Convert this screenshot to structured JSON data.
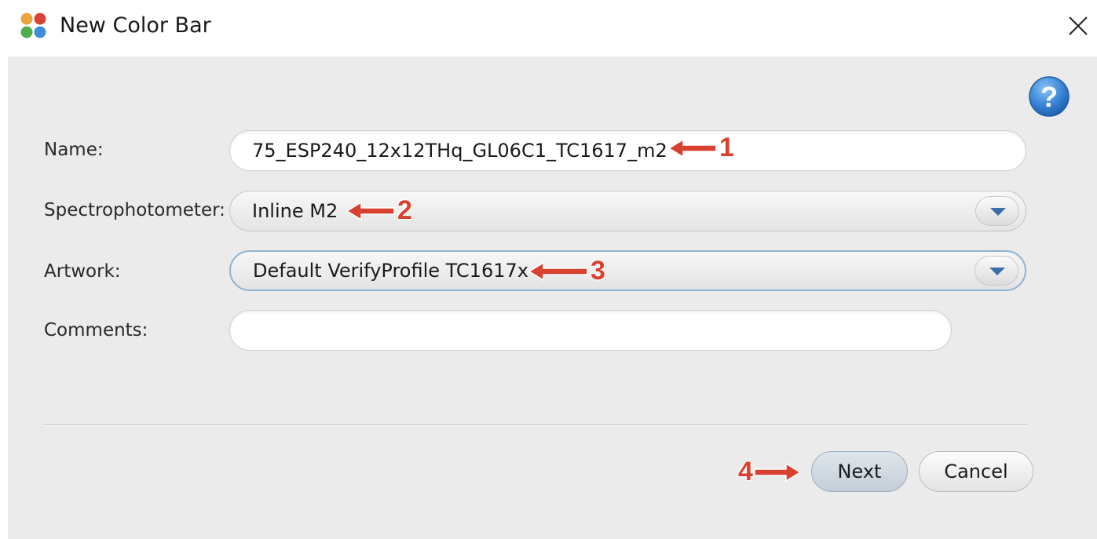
{
  "window": {
    "title": "New Color Bar"
  },
  "form": {
    "name_label": "Name:",
    "name_value": "75_ESP240_12x12THq_GL06C1_TC1617_m2",
    "spectro_label": "Spectrophotometer:",
    "spectro_value": "Inline M2",
    "artwork_label": "Artwork:",
    "artwork_value": "Default VerifyProfile TC1617x",
    "comments_label": "Comments:",
    "comments_value": ""
  },
  "annotations": [
    "1",
    "2",
    "3",
    "4"
  ],
  "buttons": {
    "next": "Next",
    "cancel": "Cancel"
  },
  "icons": {
    "app": "color-dots-icon",
    "close": "close-icon",
    "help": "help-icon",
    "dropdown": "chevron-down-icon",
    "annotation_arrow": "arrow-left-icon"
  },
  "colors": {
    "annotation": "#d8402f",
    "help_blue": "#3a86d6"
  }
}
